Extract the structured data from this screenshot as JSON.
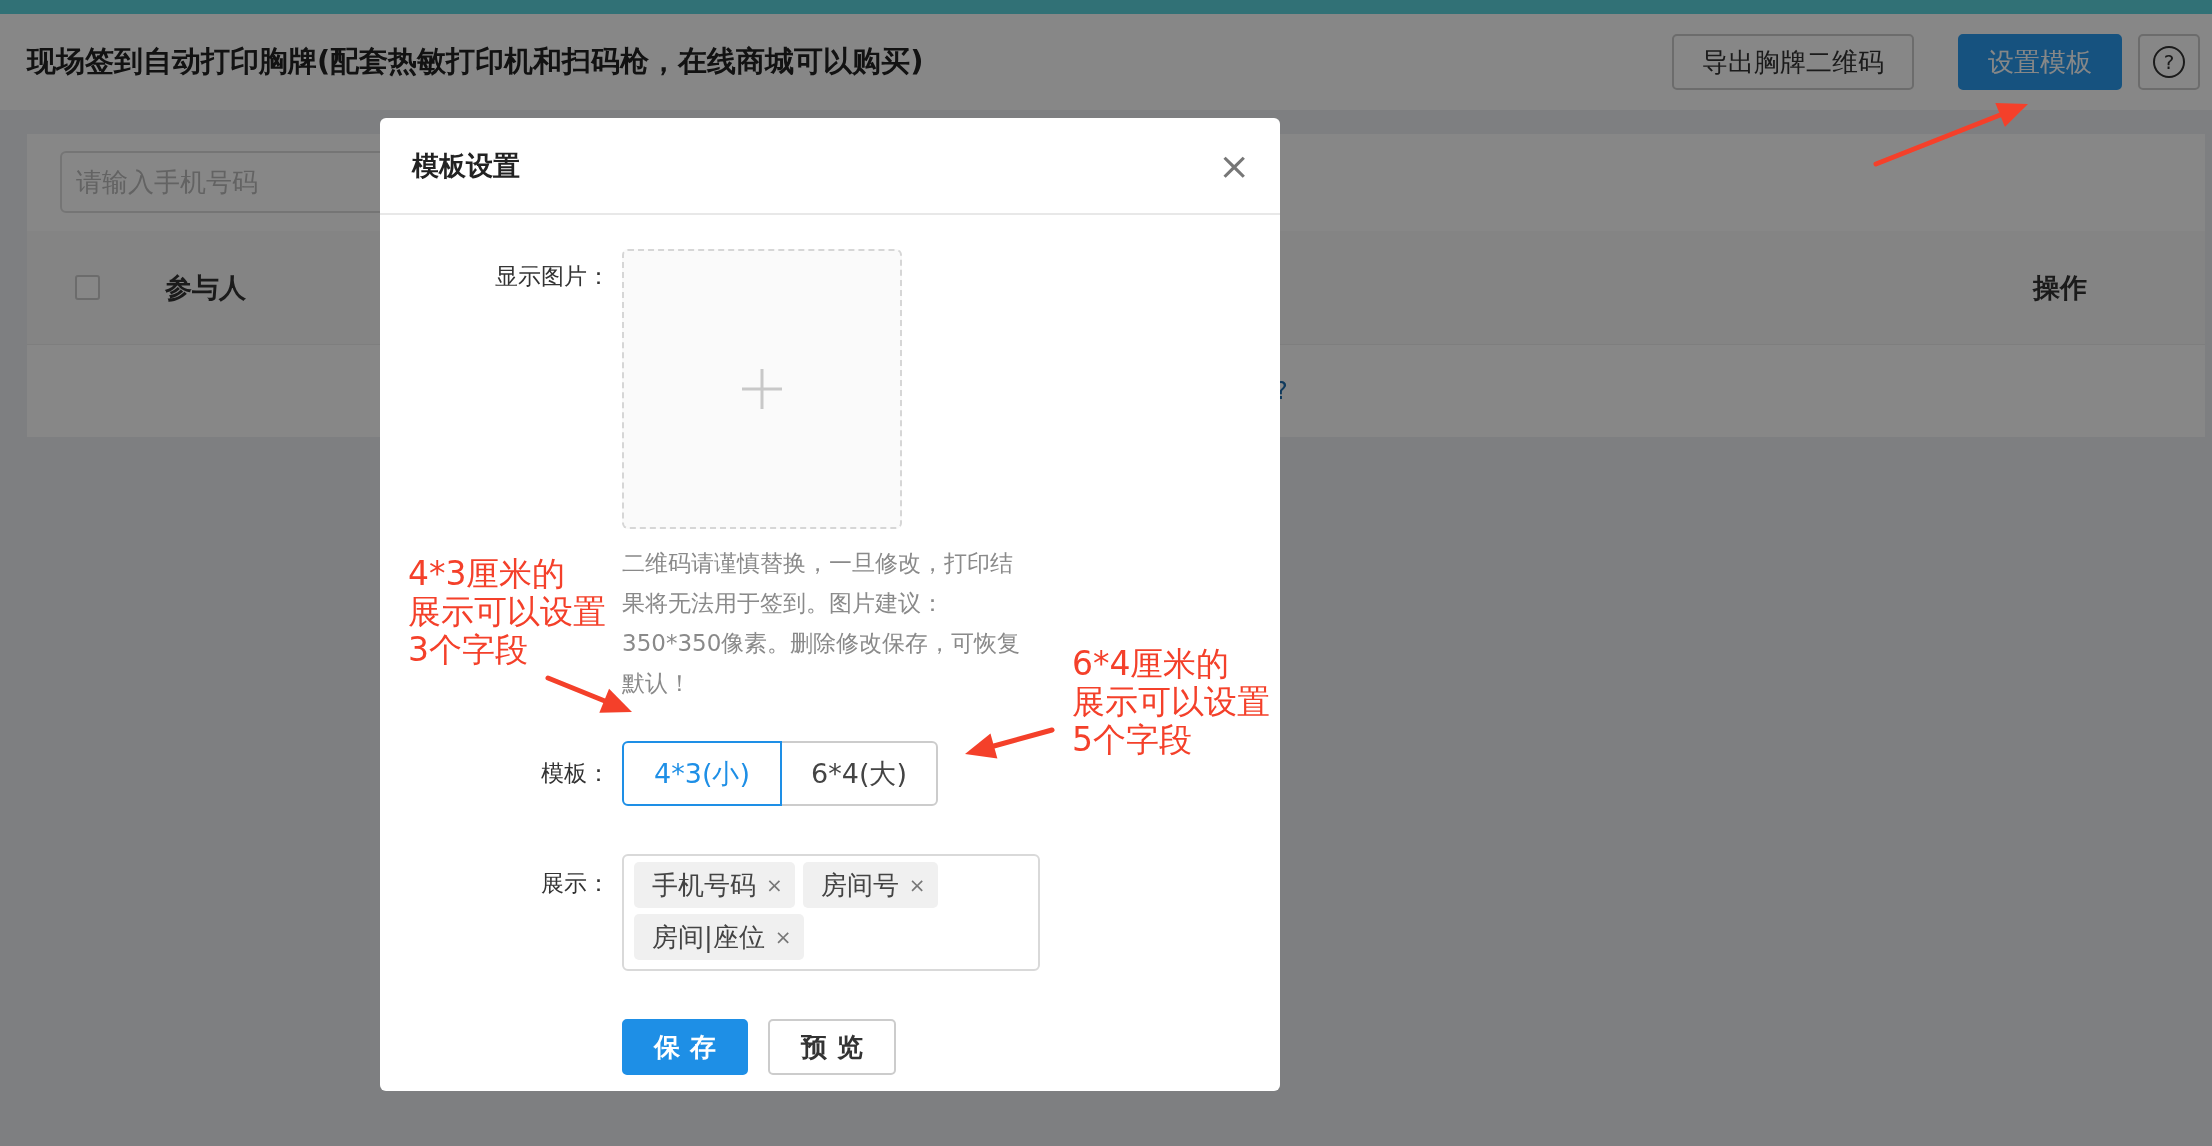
{
  "header": {
    "title": "现场签到自动打印胸牌(配套热敏打印机和扫码枪，在线商城可以购买)",
    "buttons": [
      {
        "label": "导出胸牌二维码",
        "kind": "default"
      },
      {
        "label": "设置模板",
        "kind": "primary"
      },
      {
        "label": "?",
        "kind": "help"
      }
    ]
  },
  "search": {
    "placeholder": "请输入手机号码"
  },
  "table": {
    "columns": [
      "参与人",
      "操作"
    ],
    "checked": false,
    "empty_row": "?"
  },
  "modal": {
    "title": "模板设置",
    "close": "×",
    "image_label": "显示图片：",
    "hint": "二维码请谨慎替换，一旦修改，打印结果将无法用于签到。图片建议：350*350像素。删除修改保存，可恢复默认！",
    "template_label": "模板：",
    "template_options": [
      {
        "label": "4*3(小)",
        "selected": true
      },
      {
        "label": "6*4(大)",
        "selected": false
      }
    ],
    "display_label": "展示：",
    "display_tags": [
      {
        "label": "手机号码",
        "remove": "×"
      },
      {
        "label": "房间号",
        "remove": "×"
      },
      {
        "label": "房间|座位",
        "remove": "×"
      }
    ],
    "buttons": [
      {
        "label": "保 存",
        "kind": "primary"
      },
      {
        "label": "预 览",
        "kind": "default"
      }
    ]
  },
  "annotations": [
    {
      "lines": [
        "4*3厘米的",
        "展示可以设置",
        "3个字段"
      ]
    },
    {
      "lines": [
        "6*4厘米的",
        "展示可以设置",
        "5个字段"
      ]
    }
  ]
}
